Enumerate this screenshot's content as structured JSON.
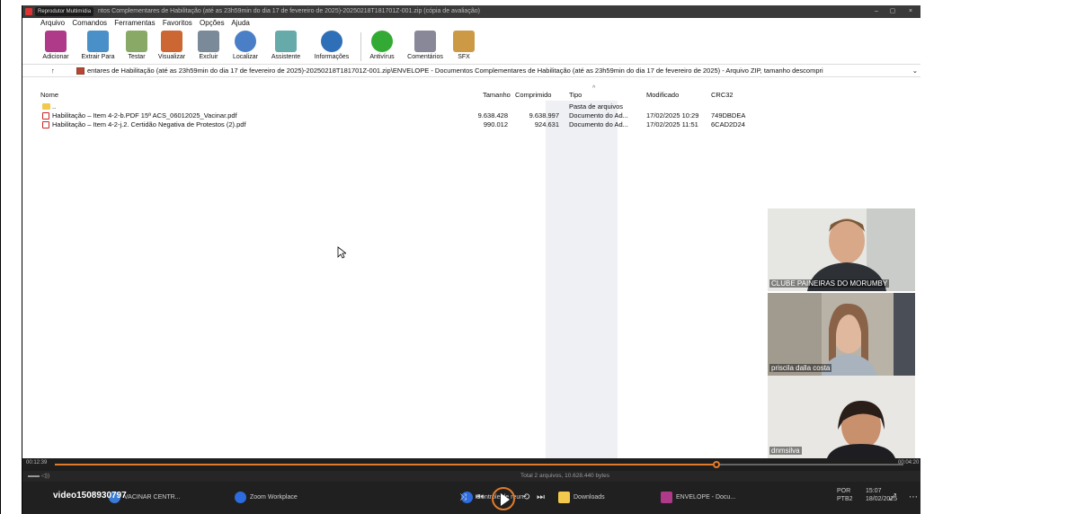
{
  "titlebar": {
    "badge": "Reprodutor Multimídia",
    "title": "ntos Complementares de Habilitação (até as 23h59min do dia 17 de fevereiro de 2025)-20250218T181701Z-001.zip (cópia de avaliação)",
    "minimize": "–",
    "maximize": "▢",
    "close": "×"
  },
  "menu": [
    "Arquivo",
    "Comandos",
    "Ferramentas",
    "Favoritos",
    "Opções",
    "Ajuda"
  ],
  "toolbar": [
    {
      "label": "Adicionar",
      "icon": "archive-add-icon",
      "color": "#b03a8a"
    },
    {
      "label": "Extrair Para",
      "icon": "folder-extract-icon",
      "color": "#4a90c8"
    },
    {
      "label": "Testar",
      "icon": "test-icon",
      "color": "#8a6"
    },
    {
      "label": "Visualizar",
      "icon": "book-icon",
      "color": "#c63"
    },
    {
      "label": "Excluir",
      "icon": "trash-icon",
      "color": "#7a8a99"
    },
    {
      "label": "Localizar",
      "icon": "magnifier-icon",
      "color": "#4a7fc8"
    },
    {
      "label": "Assistente",
      "icon": "wand-icon",
      "color": "#6aa"
    },
    {
      "label": "Informações",
      "icon": "info-icon",
      "color": "#2f6fb8"
    },
    {
      "label": "Antivírus",
      "icon": "antivirus-icon",
      "color": "#3a3"
    },
    {
      "label": "Comentários",
      "icon": "comments-icon",
      "color": "#889"
    },
    {
      "label": "SFX",
      "icon": "sfx-icon",
      "color": "#c94"
    }
  ],
  "address": {
    "up": "↑",
    "path": "entares de Habilitação (até as 23h59min do dia 17 de fevereiro de 2025)-20250218T181701Z-001.zip\\ENVELOPE - Documentos Complementares de Habilitação (até as 23h59min do dia 17 de fevereiro de 2025) - Arquivo ZIP, tamanho descompri",
    "dropdown": "⌄"
  },
  "columns": {
    "name": "Nome",
    "size": "Tamanho",
    "packed": "Comprimido",
    "type": "Tipo",
    "modified": "Modificado",
    "crc": "CRC32",
    "sort_arrow": "^"
  },
  "files": [
    {
      "name": "..",
      "size": "",
      "packed": "",
      "type": "Pasta de arquivos",
      "modified": "",
      "crc": "",
      "kind": "folder"
    },
    {
      "name": "Habilitação – Item 4-2-b.PDF  15ª ACS_06012025_Vacinar.pdf",
      "size": "9.638.428",
      "packed": "9.638.997",
      "type": "Documento do Ad...",
      "modified": "17/02/2025 10:29",
      "crc": "749DBDEA",
      "kind": "pdf"
    },
    {
      "name": "Habilitação – Item 4-2-j.2. Certidão Negativa de Protestos (2).pdf",
      "size": "990.012",
      "packed": "924.631",
      "type": "Documento do Ad...",
      "modified": "17/02/2025 11:51",
      "crc": "6CAD2D24",
      "kind": "pdf"
    }
  ],
  "participants": [
    {
      "name": "CLUBE PAINEIRAS DO MORUMBY"
    },
    {
      "name": "priscila dalla costa"
    },
    {
      "name": "dnmsilva"
    }
  ],
  "player": {
    "elapsed": "00:12:39",
    "remaining": "00:04:20",
    "progress_fraction": 0.78
  },
  "status": {
    "summary": "Total 2 arquivos, 10.628.440 bytes",
    "left": "▬▬ ◁))"
  },
  "video_id": "video1508930797",
  "taskbar": {
    "items": [
      {
        "label": "VACINAR CENTR...",
        "color": "#3a7bd5"
      },
      {
        "label": "Zoom Workplace",
        "color": "#2d6cdf"
      },
      {
        "label": "Controle de reun...",
        "color": "#2d6cdf"
      },
      {
        "label": "Downloads",
        "color": "#f2c94c"
      },
      {
        "label": "ENVELOPE - Docu...",
        "color": "#b03a8a"
      }
    ],
    "lang": "POR",
    "layout": "PTB2",
    "time": "15:07",
    "date": "18/02/2025"
  }
}
